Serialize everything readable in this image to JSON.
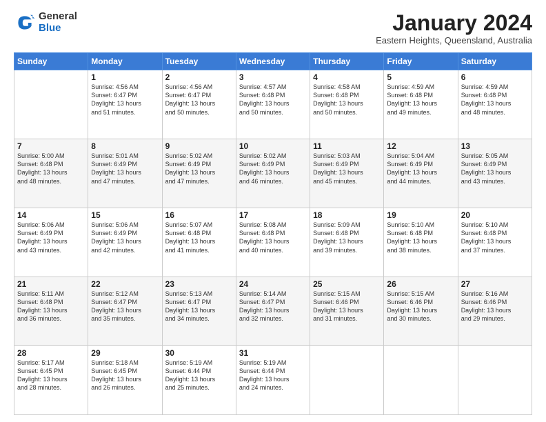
{
  "logo": {
    "general": "General",
    "blue": "Blue"
  },
  "header": {
    "title": "January 2024",
    "subtitle": "Eastern Heights, Queensland, Australia"
  },
  "weekdays": [
    "Sunday",
    "Monday",
    "Tuesday",
    "Wednesday",
    "Thursday",
    "Friday",
    "Saturday"
  ],
  "weeks": [
    [
      {
        "day": "",
        "info": ""
      },
      {
        "day": "1",
        "info": "Sunrise: 4:56 AM\nSunset: 6:47 PM\nDaylight: 13 hours\nand 51 minutes."
      },
      {
        "day": "2",
        "info": "Sunrise: 4:56 AM\nSunset: 6:47 PM\nDaylight: 13 hours\nand 50 minutes."
      },
      {
        "day": "3",
        "info": "Sunrise: 4:57 AM\nSunset: 6:48 PM\nDaylight: 13 hours\nand 50 minutes."
      },
      {
        "day": "4",
        "info": "Sunrise: 4:58 AM\nSunset: 6:48 PM\nDaylight: 13 hours\nand 50 minutes."
      },
      {
        "day": "5",
        "info": "Sunrise: 4:59 AM\nSunset: 6:48 PM\nDaylight: 13 hours\nand 49 minutes."
      },
      {
        "day": "6",
        "info": "Sunrise: 4:59 AM\nSunset: 6:48 PM\nDaylight: 13 hours\nand 48 minutes."
      }
    ],
    [
      {
        "day": "7",
        "info": "Sunrise: 5:00 AM\nSunset: 6:48 PM\nDaylight: 13 hours\nand 48 minutes."
      },
      {
        "day": "8",
        "info": "Sunrise: 5:01 AM\nSunset: 6:49 PM\nDaylight: 13 hours\nand 47 minutes."
      },
      {
        "day": "9",
        "info": "Sunrise: 5:02 AM\nSunset: 6:49 PM\nDaylight: 13 hours\nand 47 minutes."
      },
      {
        "day": "10",
        "info": "Sunrise: 5:02 AM\nSunset: 6:49 PM\nDaylight: 13 hours\nand 46 minutes."
      },
      {
        "day": "11",
        "info": "Sunrise: 5:03 AM\nSunset: 6:49 PM\nDaylight: 13 hours\nand 45 minutes."
      },
      {
        "day": "12",
        "info": "Sunrise: 5:04 AM\nSunset: 6:49 PM\nDaylight: 13 hours\nand 44 minutes."
      },
      {
        "day": "13",
        "info": "Sunrise: 5:05 AM\nSunset: 6:49 PM\nDaylight: 13 hours\nand 43 minutes."
      }
    ],
    [
      {
        "day": "14",
        "info": "Sunrise: 5:06 AM\nSunset: 6:49 PM\nDaylight: 13 hours\nand 43 minutes."
      },
      {
        "day": "15",
        "info": "Sunrise: 5:06 AM\nSunset: 6:49 PM\nDaylight: 13 hours\nand 42 minutes."
      },
      {
        "day": "16",
        "info": "Sunrise: 5:07 AM\nSunset: 6:48 PM\nDaylight: 13 hours\nand 41 minutes."
      },
      {
        "day": "17",
        "info": "Sunrise: 5:08 AM\nSunset: 6:48 PM\nDaylight: 13 hours\nand 40 minutes."
      },
      {
        "day": "18",
        "info": "Sunrise: 5:09 AM\nSunset: 6:48 PM\nDaylight: 13 hours\nand 39 minutes."
      },
      {
        "day": "19",
        "info": "Sunrise: 5:10 AM\nSunset: 6:48 PM\nDaylight: 13 hours\nand 38 minutes."
      },
      {
        "day": "20",
        "info": "Sunrise: 5:10 AM\nSunset: 6:48 PM\nDaylight: 13 hours\nand 37 minutes."
      }
    ],
    [
      {
        "day": "21",
        "info": "Sunrise: 5:11 AM\nSunset: 6:48 PM\nDaylight: 13 hours\nand 36 minutes."
      },
      {
        "day": "22",
        "info": "Sunrise: 5:12 AM\nSunset: 6:47 PM\nDaylight: 13 hours\nand 35 minutes."
      },
      {
        "day": "23",
        "info": "Sunrise: 5:13 AM\nSunset: 6:47 PM\nDaylight: 13 hours\nand 34 minutes."
      },
      {
        "day": "24",
        "info": "Sunrise: 5:14 AM\nSunset: 6:47 PM\nDaylight: 13 hours\nand 32 minutes."
      },
      {
        "day": "25",
        "info": "Sunrise: 5:15 AM\nSunset: 6:46 PM\nDaylight: 13 hours\nand 31 minutes."
      },
      {
        "day": "26",
        "info": "Sunrise: 5:15 AM\nSunset: 6:46 PM\nDaylight: 13 hours\nand 30 minutes."
      },
      {
        "day": "27",
        "info": "Sunrise: 5:16 AM\nSunset: 6:46 PM\nDaylight: 13 hours\nand 29 minutes."
      }
    ],
    [
      {
        "day": "28",
        "info": "Sunrise: 5:17 AM\nSunset: 6:45 PM\nDaylight: 13 hours\nand 28 minutes."
      },
      {
        "day": "29",
        "info": "Sunrise: 5:18 AM\nSunset: 6:45 PM\nDaylight: 13 hours\nand 26 minutes."
      },
      {
        "day": "30",
        "info": "Sunrise: 5:19 AM\nSunset: 6:44 PM\nDaylight: 13 hours\nand 25 minutes."
      },
      {
        "day": "31",
        "info": "Sunrise: 5:19 AM\nSunset: 6:44 PM\nDaylight: 13 hours\nand 24 minutes."
      },
      {
        "day": "",
        "info": ""
      },
      {
        "day": "",
        "info": ""
      },
      {
        "day": "",
        "info": ""
      }
    ]
  ]
}
